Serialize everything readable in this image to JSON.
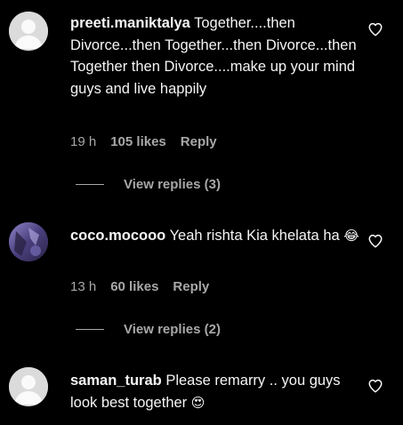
{
  "comments": [
    {
      "username": "preeti.maniktalya",
      "text": "Together....then Divorce...then Together...then Divorce...then Together then Divorce....make up your mind guys and live happily",
      "time": "19 h",
      "likes": "105 likes",
      "reply_label": "Reply",
      "view_replies": "View replies (3)",
      "avatar": "default-avatar"
    },
    {
      "username": "coco.mocooo",
      "text": "Yeah rishta Kia khelata ha",
      "emoji": "😂",
      "time": "13 h",
      "likes": "60 likes",
      "reply_label": "Reply",
      "view_replies": "View replies (2)",
      "avatar": "photo-avatar"
    },
    {
      "username": "saman_turab",
      "text": "Please remarry .. you guys look best together",
      "emoji": "😍",
      "avatar": "default-avatar"
    }
  ],
  "icons": {
    "like": "heart-outline-icon"
  },
  "colors": {
    "background": "#000000",
    "text": "#f5f5f5",
    "secondary": "#a8a8a8"
  }
}
